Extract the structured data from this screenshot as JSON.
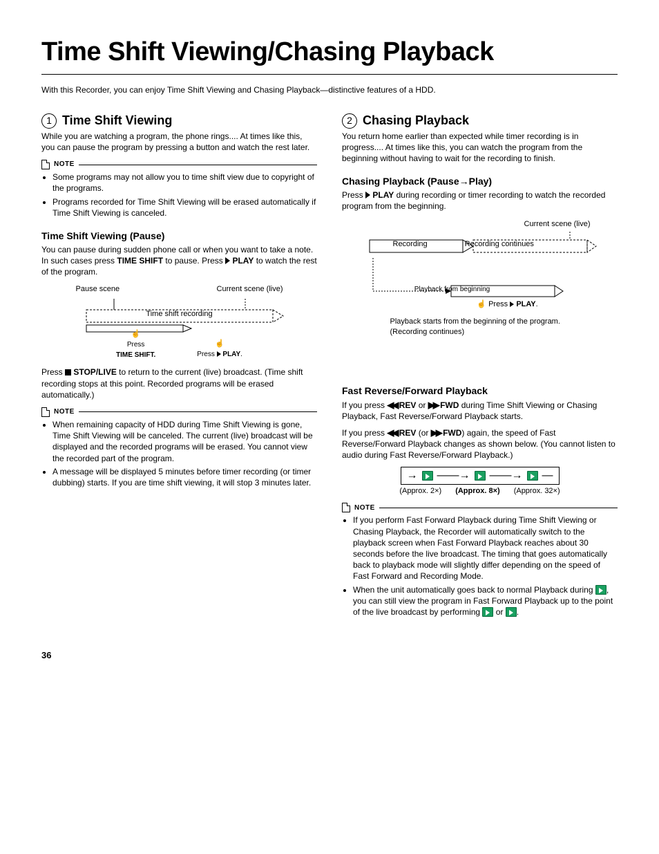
{
  "page": {
    "title": "Time Shift Viewing/Chasing Playback",
    "intro": "With this Recorder, you can enjoy Time Shift Viewing and Chasing Playback—distinctive features of a HDD.",
    "page_number": "36"
  },
  "left": {
    "h2_num": "1",
    "h2": "Time Shift Viewing",
    "p1": "While you are watching a program, the phone rings.... At times like this, you can pause the program by pressing a button and watch the rest later.",
    "note1_label": "NOTE",
    "note1_items": [
      "Some programs may not allow you to time shift view due to copyright of the programs.",
      "Programs recorded for Time Shift Viewing will be erased automatically if Time Shift Viewing is canceled."
    ],
    "h3a": "Time Shift Viewing (Pause)",
    "p2_a": "You can pause during sudden phone call or when you want to take a note. In such cases press ",
    "p2_ts": "TIME SHIFT",
    "p2_b": " to pause. Press ",
    "p2_play": "PLAY",
    "p2_c": " to watch the rest of the program.",
    "dia1": {
      "pause_scene": "Pause scene",
      "current_scene": "Current scene (live)",
      "tsr": "Time shift recording",
      "press": "Press",
      "time_shift": "TIME SHIFT",
      "press_play": "Press",
      "play": "PLAY"
    },
    "p3_a": "Press ",
    "p3_stop": "STOP/LIVE",
    "p3_b": " to return to the current (live) broadcast. (Time shift recording stops at this point. Recorded programs will be erased automatically.)",
    "note2_label": "NOTE",
    "note2_items": [
      "When remaining capacity of HDD during Time Shift Viewing is gone, Time Shift Viewing will be canceled. The current (live) broadcast will be displayed and the recorded programs will be erased. You cannot view the recorded part of the program.",
      "A message will be displayed 5 minutes before timer recording (or timer dubbing) starts. If you are time shift viewing, it will stop 3 minutes later."
    ]
  },
  "right": {
    "h2_num": "2",
    "h2": "Chasing Playback",
    "p1": "You return home earlier than expected while timer recording is in progress.... At times like this, you can watch the program from the beginning without having to wait for the recording to finish.",
    "h3a": "Chasing Playback (Pause→Play)",
    "p2_a": "Press ",
    "p2_play": "PLAY",
    "p2_b": " during recording or timer recording to watch the recorded program from the beginning.",
    "dia2": {
      "current_scene": "Current scene (live)",
      "recording": "Recording",
      "recording_cont": "Recording continues",
      "playback_begin": "Playback from beginning",
      "press": "Press",
      "play": "PLAY",
      "caption": "Playback starts from the beginning of the program. (Recording continues)"
    },
    "h3b": "Fast Reverse/Forward Playback",
    "p3_a": "If you press ",
    "p3_rev": "REV",
    "p3_or": " or ",
    "p3_fwd": "FWD",
    "p3_b": " during Time Shift Viewing or Chasing Playback, Fast Reverse/Forward Playback starts.",
    "p4_a": "If you press ",
    "p4_rev": "REV",
    "p4_mid": " (or ",
    "p4_fwd": "FWD",
    "p4_b": ") again, the speed of Fast Reverse/Forward Playback changes as shown below. (You cannot listen to audio during Fast Reverse/Forward Playback.)",
    "speeds": {
      "s1": "(Approx. 2×)",
      "s2": "(Approx. 8×)",
      "s3": "(Approx. 32×)"
    },
    "note3_label": "NOTE",
    "note3_item1": "If you perform Fast Forward Playback during Time Shift Viewing or Chasing Playback, the Recorder will automatically switch to the playback screen when Fast Forward Playback reaches about 30 seconds before the live broadcast. The timing that goes automatically back to playback mode will slightly differ depending on the speed of Fast Forward and Recording Mode.",
    "note3_item2_a": "When the unit automatically goes back to normal Playback during ",
    "note3_item2_b": ", you can still view the program in Fast Forward Playback up to the point of the live broadcast by performing ",
    "note3_item2_c": " or ",
    "note3_item2_d": "."
  }
}
